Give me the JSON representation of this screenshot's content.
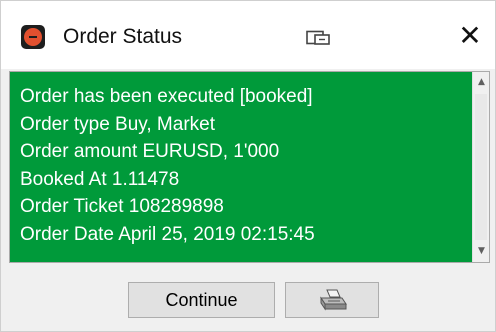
{
  "window": {
    "title": "Order Status",
    "app_icon": "app-logo-icon",
    "restore_icon": "restore-window-icon",
    "close_glyph": "✕"
  },
  "message": {
    "lines": [
      "Order has been executed [booked]",
      "Order type Buy, Market",
      "Order amount EURUSD, 1'000",
      "Booked At 1.11478",
      "Order Ticket 108289898",
      "Order Date April 25, 2019 02:15:45"
    ],
    "background_color": "#009a3a",
    "text_color": "#ffffff"
  },
  "scrollbar": {
    "up_glyph": "▲",
    "down_glyph": "▼"
  },
  "buttons": {
    "continue_label": "Continue",
    "print_icon": "printer-icon"
  }
}
